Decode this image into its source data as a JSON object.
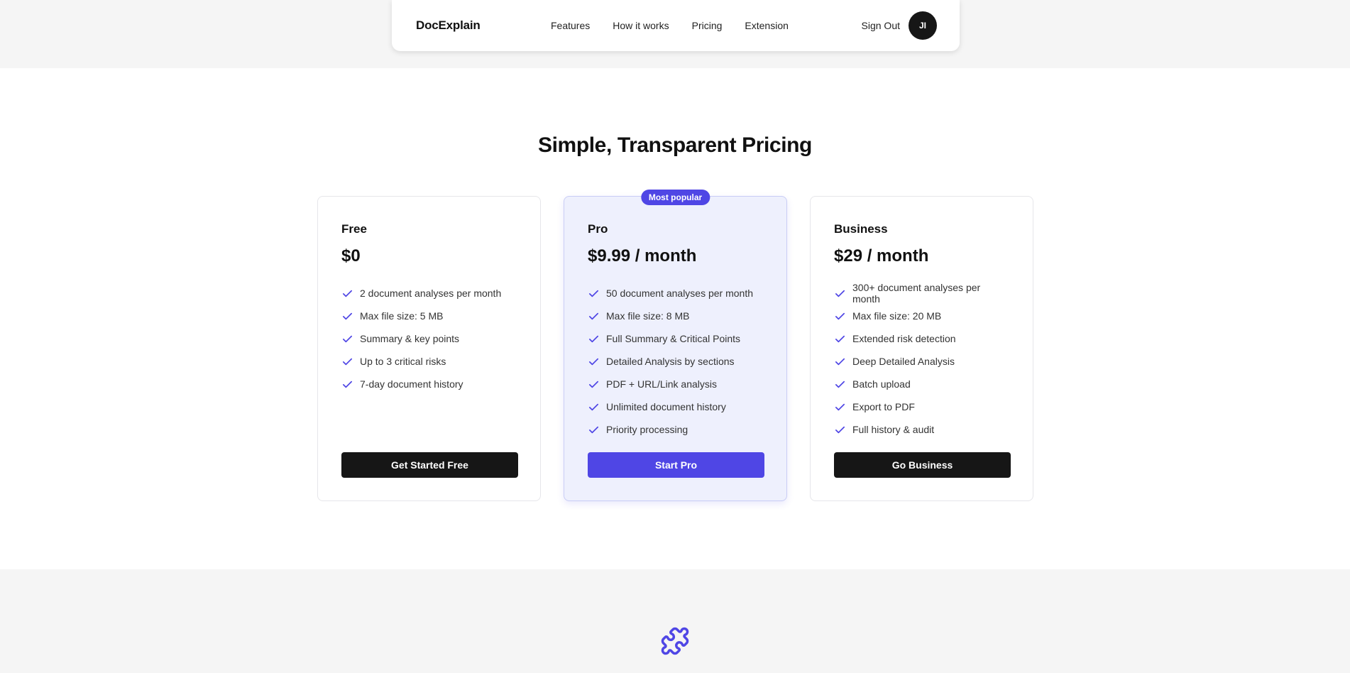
{
  "nav": {
    "brand": "DocExplain",
    "links": [
      "Features",
      "How it works",
      "Pricing",
      "Extension"
    ],
    "sign_out": "Sign Out",
    "avatar_initials": "JI"
  },
  "pricing": {
    "title": "Simple, Transparent Pricing",
    "plans": [
      {
        "name": "Free",
        "price": "$0",
        "features": [
          "2 document analyses per month",
          "Max file size: 5 MB",
          "Summary & key points",
          "Up to 3 critical risks",
          "7-day document history"
        ],
        "cta": "Get Started Free"
      },
      {
        "name": "Pro",
        "badge": "Most popular",
        "price": "$9.99 / month",
        "features": [
          "50 document analyses per month",
          "Max file size: 8 MB",
          "Full Summary & Critical Points",
          "Detailed Analysis by sections",
          "PDF + URL/Link analysis",
          "Unlimited document history",
          "Priority processing"
        ],
        "cta": "Start Pro"
      },
      {
        "name": "Business",
        "price": "$29 / month",
        "features": [
          "300+ document analyses per month",
          "Max file size: 20 MB",
          "Extended risk detection",
          "Deep Detailed Analysis",
          "Batch upload",
          "Export to PDF",
          "Full history & audit"
        ],
        "cta": "Go Business"
      }
    ]
  },
  "colors": {
    "accent": "#4f46e5",
    "dark_button": "#161616",
    "pro_card_bg": "#eef0fd"
  },
  "icons": {
    "check": "check-icon",
    "puzzle": "puzzle-icon"
  }
}
